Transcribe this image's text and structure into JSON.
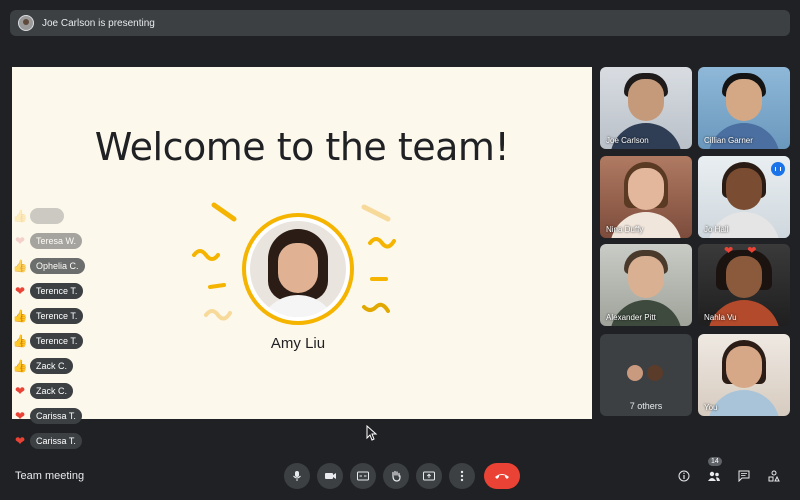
{
  "presenter_bar": {
    "text": "Joe Carlson is presenting"
  },
  "slide": {
    "title": "Welcome to the team!",
    "name": "Amy Liu"
  },
  "reactions": [
    {
      "emoji": "👍",
      "name": ""
    },
    {
      "emoji": "❤️",
      "name": "Teresa W."
    },
    {
      "emoji": "👍",
      "name": "Ophelia C."
    },
    {
      "emoji": "❤️",
      "name": "Terence T."
    },
    {
      "emoji": "👍",
      "name": "Terence T."
    },
    {
      "emoji": "👍",
      "name": "Terence T."
    },
    {
      "emoji": "👍",
      "name": "Zack C."
    },
    {
      "emoji": "❤️",
      "name": "Zack C."
    },
    {
      "emoji": "❤️",
      "name": "Carissa T."
    },
    {
      "emoji": "❤️",
      "name": "Carissa T."
    }
  ],
  "participants": [
    {
      "name": "Joe Carlson"
    },
    {
      "name": "Cillian Garner"
    },
    {
      "name": "Nina Duffy"
    },
    {
      "name": "Jo Hall"
    },
    {
      "name": "Alexander Pitt"
    },
    {
      "name": "Nahla Vu"
    },
    {
      "name": "You"
    }
  ],
  "others": {
    "label": "7 others"
  },
  "meeting": {
    "name": "Team meeting"
  },
  "people_count": "14",
  "colors": {
    "end_call": "#ea4335",
    "accent": "#8ab4f8",
    "slide_bg": "#fdf8ec",
    "ring": "#f4b400"
  }
}
